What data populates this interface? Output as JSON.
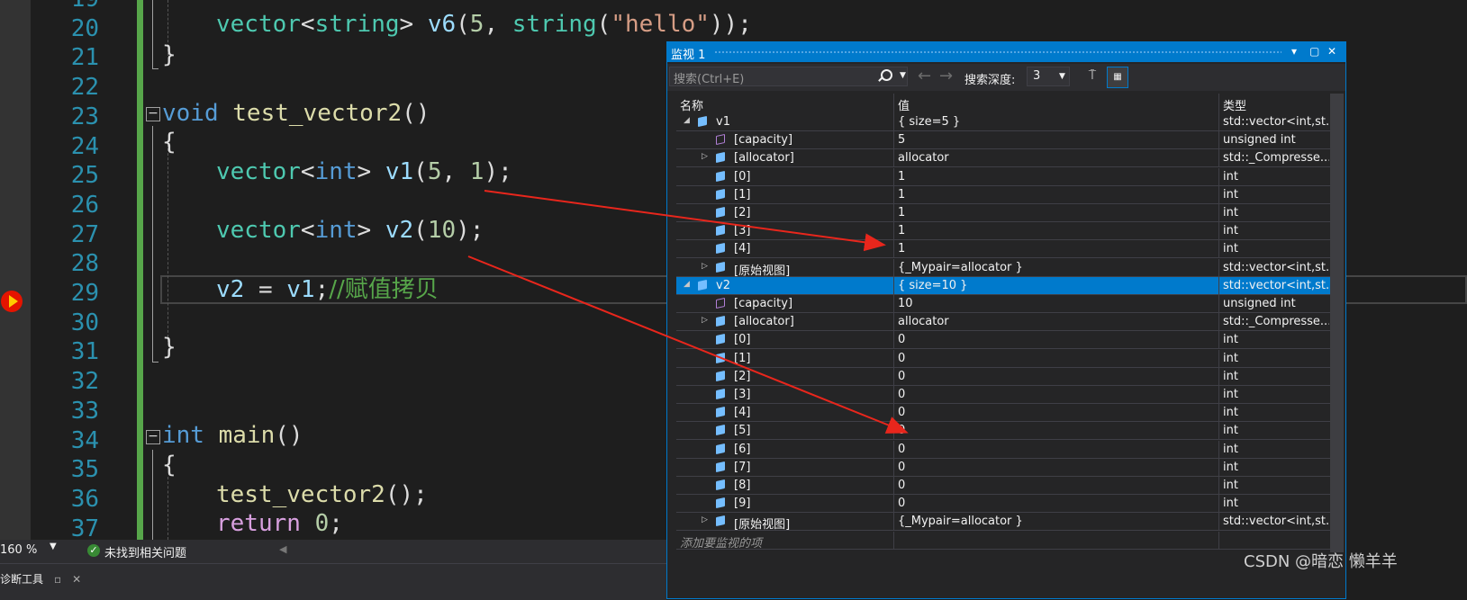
{
  "editor": {
    "lines": [
      {
        "n": "19"
      },
      {
        "n": "20"
      },
      {
        "n": "21"
      },
      {
        "n": "22"
      },
      {
        "n": "23"
      },
      {
        "n": "24"
      },
      {
        "n": "25"
      },
      {
        "n": "26"
      },
      {
        "n": "27"
      },
      {
        "n": "28"
      },
      {
        "n": "29"
      },
      {
        "n": "30"
      },
      {
        "n": "31"
      },
      {
        "n": "32"
      },
      {
        "n": "33"
      },
      {
        "n": "34"
      },
      {
        "n": "35"
      },
      {
        "n": "36"
      },
      {
        "n": "37"
      }
    ],
    "code": {
      "l20": {
        "a": "vector",
        "b": "<",
        "c": "string",
        "d": "> ",
        "e": "v6",
        "f": "(",
        "g": "5",
        ",": ", ",
        "h": "string",
        "i": "(",
        "j": "\"hello\"",
        "k": "));"
      },
      "l21": "}",
      "l23": {
        "kw": "void",
        "fn": "test_vector2",
        "rest": "()"
      },
      "l24": "{",
      "l25": {
        "t": "vector",
        "lt": "<",
        "kw": "int",
        "gt": "> ",
        "v": "v1",
        "p": "(",
        "n1": "5",
        "c": ", ",
        "n2": "1",
        "e": ");"
      },
      "l27": {
        "t": "vector",
        "lt": "<",
        "kw": "int",
        "gt": "> ",
        "v": "v2",
        "p": "(",
        "n1": "10",
        "e": ");"
      },
      "l29": {
        "v2": "v2",
        "eq": " = ",
        "v1": "v1",
        "semi": ";",
        "comment": "//赋值拷贝"
      },
      "l31": "}",
      "l34": {
        "kw": "int",
        "fn": "main",
        "rest": "()"
      },
      "l35": "{",
      "l36": {
        "fn": "test_vector2",
        "rest": "();"
      },
      "l37": {
        "kw": "return",
        "n": "0",
        "semi": ";"
      }
    }
  },
  "status": {
    "zoom": "160 %",
    "issues": "未找到相关问题",
    "bottom_tab": "诊断工具"
  },
  "watch": {
    "title": "监视 1",
    "search_placeholder": "搜索(Ctrl+E)",
    "depth_label": "搜索深度:",
    "depth_value": "3",
    "columns": {
      "name": "名称",
      "value": "值",
      "type": "类型"
    },
    "rows": [
      {
        "indent": 0,
        "exp": "◢",
        "icon": "obj",
        "name": "v1",
        "value": "{ size=5 }",
        "type": "std::vector<int,st..."
      },
      {
        "indent": 1,
        "exp": "",
        "icon": "prop",
        "name": "[capacity]",
        "value": "5",
        "type": "unsigned int"
      },
      {
        "indent": 1,
        "exp": "▷",
        "icon": "obj",
        "name": "[allocator]",
        "value": "allocator",
        "type": "std::_Compresse..."
      },
      {
        "indent": 1,
        "exp": "",
        "icon": "obj",
        "name": "[0]",
        "value": "1",
        "type": "int"
      },
      {
        "indent": 1,
        "exp": "",
        "icon": "obj",
        "name": "[1]",
        "value": "1",
        "type": "int"
      },
      {
        "indent": 1,
        "exp": "",
        "icon": "obj",
        "name": "[2]",
        "value": "1",
        "type": "int"
      },
      {
        "indent": 1,
        "exp": "",
        "icon": "obj",
        "name": "[3]",
        "value": "1",
        "type": "int"
      },
      {
        "indent": 1,
        "exp": "",
        "icon": "obj",
        "name": "[4]",
        "value": "1",
        "type": "int"
      },
      {
        "indent": 1,
        "exp": "▷",
        "icon": "obj",
        "name": "[原始视图]",
        "value": "{_Mypair=allocator }",
        "type": "std::vector<int,st..."
      },
      {
        "indent": 0,
        "exp": "◢",
        "icon": "obj",
        "name": "v2",
        "value": "{ size=10 }",
        "type": "std::vector<int,st...",
        "selected": true
      },
      {
        "indent": 1,
        "exp": "",
        "icon": "prop",
        "name": "[capacity]",
        "value": "10",
        "type": "unsigned int"
      },
      {
        "indent": 1,
        "exp": "▷",
        "icon": "obj",
        "name": "[allocator]",
        "value": "allocator",
        "type": "std::_Compresse..."
      },
      {
        "indent": 1,
        "exp": "",
        "icon": "obj",
        "name": "[0]",
        "value": "0",
        "type": "int"
      },
      {
        "indent": 1,
        "exp": "",
        "icon": "obj",
        "name": "[1]",
        "value": "0",
        "type": "int"
      },
      {
        "indent": 1,
        "exp": "",
        "icon": "obj",
        "name": "[2]",
        "value": "0",
        "type": "int"
      },
      {
        "indent": 1,
        "exp": "",
        "icon": "obj",
        "name": "[3]",
        "value": "0",
        "type": "int"
      },
      {
        "indent": 1,
        "exp": "",
        "icon": "obj",
        "name": "[4]",
        "value": "0",
        "type": "int"
      },
      {
        "indent": 1,
        "exp": "",
        "icon": "obj",
        "name": "[5]",
        "value": "0",
        "type": "int"
      },
      {
        "indent": 1,
        "exp": "",
        "icon": "obj",
        "name": "[6]",
        "value": "0",
        "type": "int"
      },
      {
        "indent": 1,
        "exp": "",
        "icon": "obj",
        "name": "[7]",
        "value": "0",
        "type": "int"
      },
      {
        "indent": 1,
        "exp": "",
        "icon": "obj",
        "name": "[8]",
        "value": "0",
        "type": "int"
      },
      {
        "indent": 1,
        "exp": "",
        "icon": "obj",
        "name": "[9]",
        "value": "0",
        "type": "int"
      },
      {
        "indent": 1,
        "exp": "▷",
        "icon": "obj",
        "name": "[原始视图]",
        "value": "{_Mypair=allocator }",
        "type": "std::vector<int,st..."
      }
    ],
    "add_placeholder": "添加要监视的项"
  },
  "watermark": "CSDN @暗恋 懒羊羊",
  "colors": {
    "accent": "#007acc",
    "annotation_arrow": "#e8261c",
    "breakpoint": "#e51400"
  }
}
